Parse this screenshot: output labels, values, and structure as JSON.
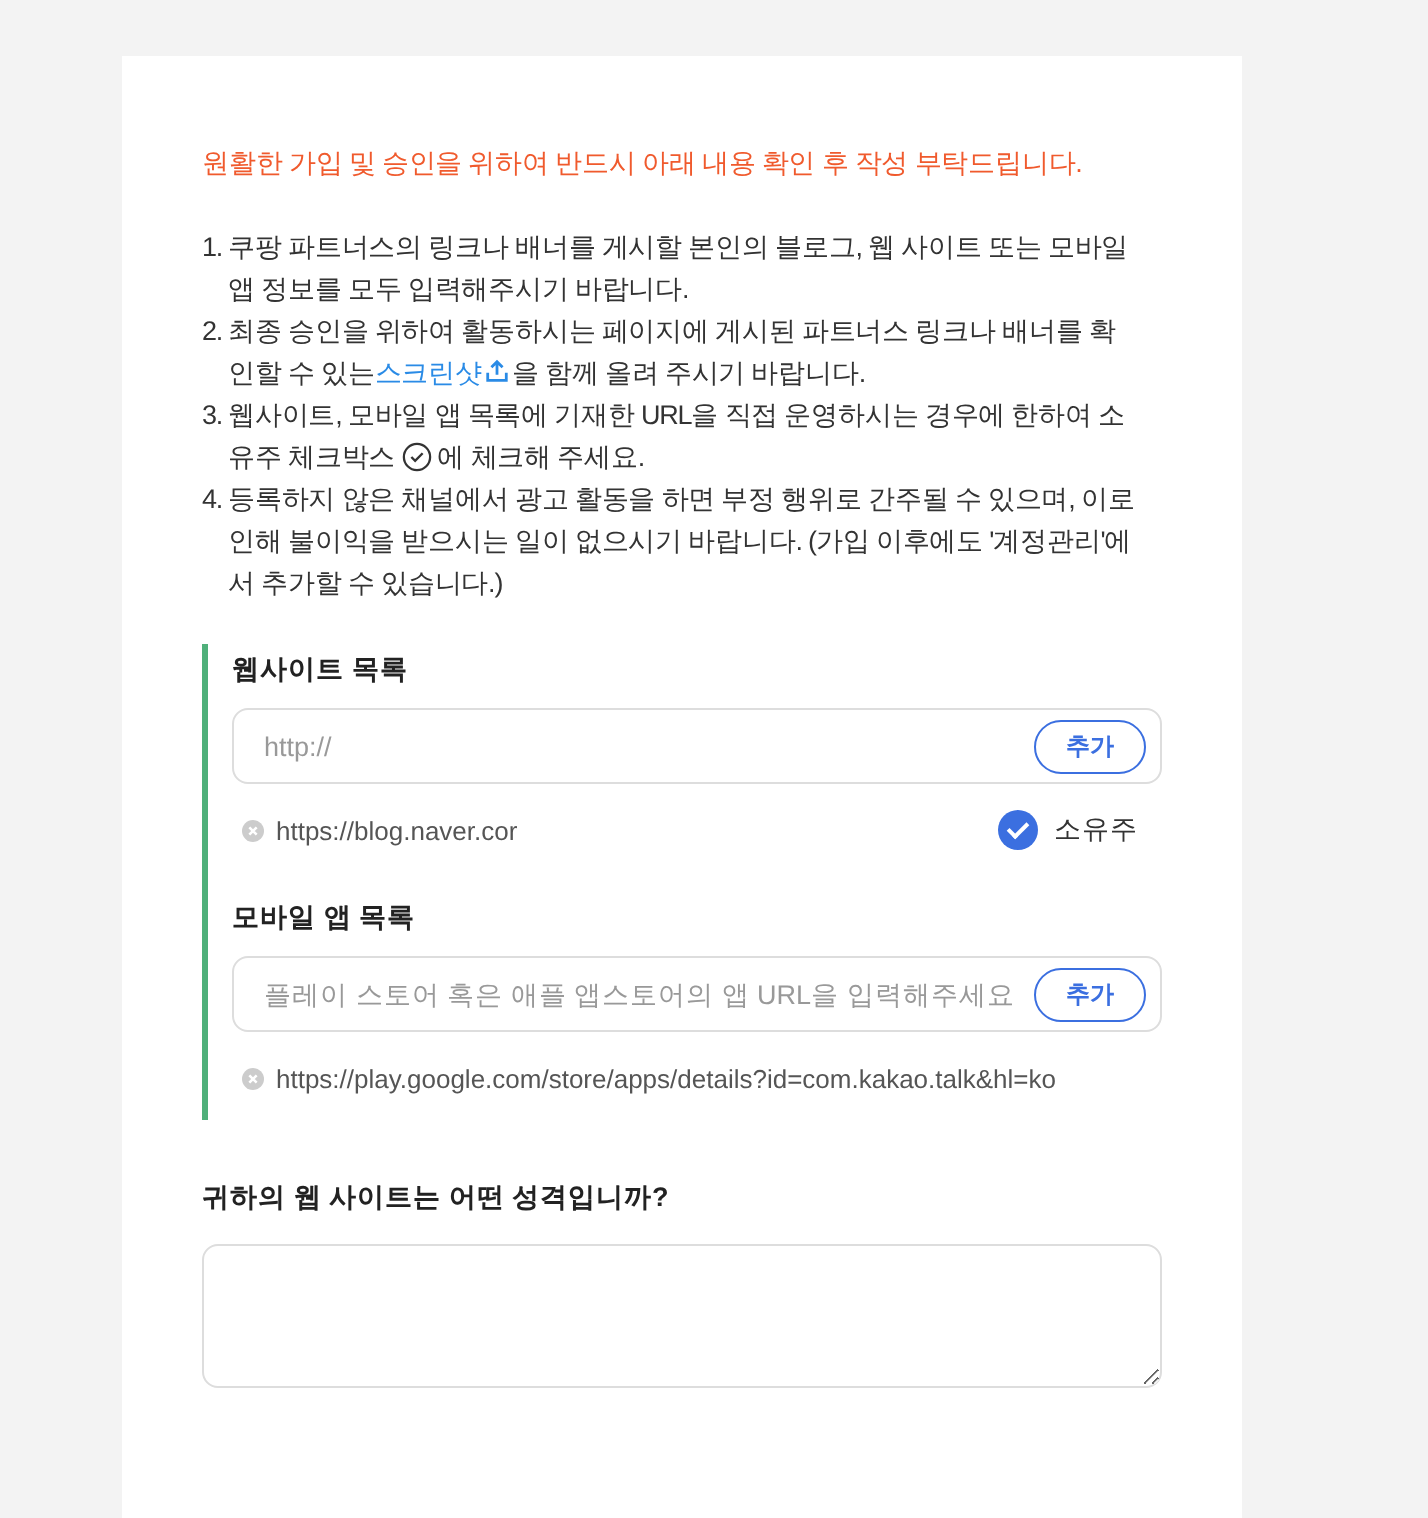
{
  "notice": "원활한 가입 및 승인을 위하여 반드시 아래 내용 확인 후 작성 부탁드립니다.",
  "instructions": [
    {
      "number": "1.",
      "segments": [
        {
          "kind": "text",
          "text": "쿠팡 파트너스의 링크나 배너를 게시할 본인의 블로그, 웹 사이트 또는 모바일 앱 정보를 모두 입력해주시기 바랍니다."
        }
      ]
    },
    {
      "number": "2.",
      "segments": [
        {
          "kind": "text",
          "text": "최종 승인을 위하여 활동하시는 페이지에 게시된 파트너스 링크나 배너를 확인할 수 있는"
        },
        {
          "kind": "link",
          "text": "스크린샷"
        },
        {
          "kind": "upload-icon"
        },
        {
          "kind": "text",
          "text": "을 함께 올려 주시기 바랍니다."
        }
      ]
    },
    {
      "number": "3.",
      "segments": [
        {
          "kind": "text",
          "text": "웹사이트, 모바일 앱 목록에 기재한 URL을 직접 운영하시는 경우에 한하여 소유주 체크박스"
        },
        {
          "kind": "check-icon"
        },
        {
          "kind": "text",
          "text": " 에 체크해 주세요."
        }
      ]
    },
    {
      "number": "4.",
      "segments": [
        {
          "kind": "text",
          "text": "등록하지 않은 채널에서 광고 활동을 하면 부정 행위로 간주될 수 있으며, 이로 인해 불이익을 받으시는 일이 없으시기 바랍니다. (가입 이후에도 '계정관리'에서 추가할 수 있습니다.)"
        }
      ]
    }
  ],
  "sections": [
    {
      "title": "웹사이트 목록",
      "placeholder": "http://",
      "add_button": "추가",
      "entries": [
        {
          "url": "https://blog.naver.cor",
          "owner": {
            "label": "소유주",
            "checked": true
          }
        }
      ]
    },
    {
      "title": "모바일 앱 목록",
      "placeholder": "플레이 스토어 혹은 애플 앱스토어의 앱 URL을 입력해주세요",
      "add_button": "추가",
      "entries": [
        {
          "url": "https://play.google.com/store/apps/details?id=com.kakao.talk&hl=ko"
        }
      ]
    }
  ],
  "question": {
    "label": "귀하의 웹 사이트는 어떤 성격입니까?"
  }
}
